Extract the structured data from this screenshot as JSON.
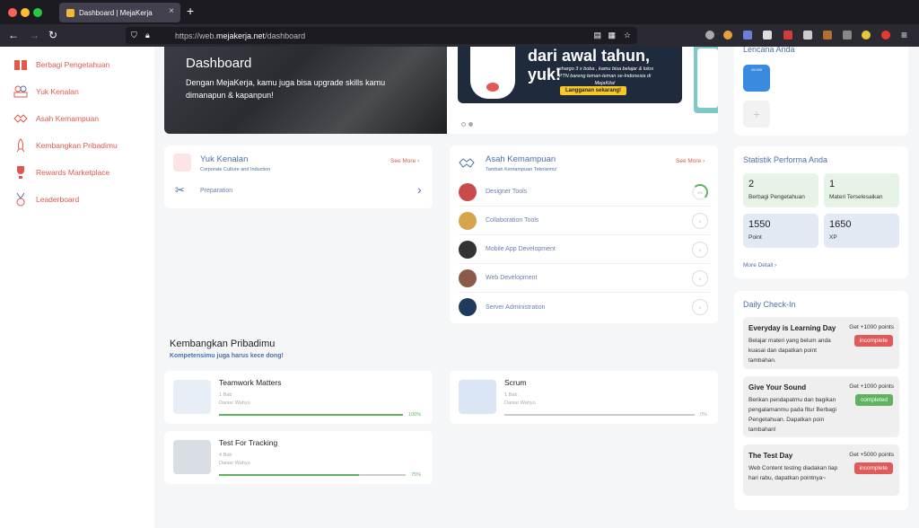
{
  "browser": {
    "tab_title": "Dashboard | MejaKerja",
    "url_prefix": "https://web.",
    "url_domain": "mejakerja.net",
    "url_path": "/dashboard"
  },
  "sidebar": {
    "items": [
      {
        "label": "Berbagi Pengetahuan"
      },
      {
        "label": "Yuk Kenalan"
      },
      {
        "label": "Asah Kemampuan"
      },
      {
        "label": "Kembangkan Pribadimu"
      },
      {
        "label": "Rewards Marketplace"
      },
      {
        "label": "Leaderboard"
      }
    ]
  },
  "hero": {
    "title": "Dashboard",
    "subtitle": "Dengan MejaKerja, kamu juga bisa upgrade skills kamu dimanapun & kapanpun!",
    "promo_title": "dari awal tahun, yuk!",
    "promo_sub": "sehargo 3 x boba , kamu bisa belajar & lolos PTN bareng teman-teman se-Indonesia di MejaKita!",
    "promo_button": "Langganan sekarang!"
  },
  "yuk_kenalan": {
    "title": "Yuk Kenalan",
    "subtitle": "Corporate Culture and Induction",
    "see_more": "See More",
    "items": [
      {
        "label": "Preparation"
      }
    ]
  },
  "asah": {
    "title": "Asah Kemampuan",
    "subtitle": "Tambah Kemampuan Teknisimu!",
    "see_more": "See More",
    "items": [
      {
        "label": "Designer Tools",
        "progress": "3%"
      },
      {
        "label": "Collaboration Tools",
        "progress": "0"
      },
      {
        "label": "Mobile App Development",
        "progress": "0"
      },
      {
        "label": "Web Development",
        "progress": "0"
      },
      {
        "label": "Server Administration",
        "progress": "0"
      }
    ]
  },
  "kembangkan": {
    "title": "Kembangkan Pribadimu",
    "subtitle": "Kompetensimu juga harus kece dong!",
    "courses": [
      {
        "title": "Teamwork Matters",
        "bab": "1 Bab",
        "author": "Daniar Wahyu",
        "pct": "100%",
        "fill": 1.0
      },
      {
        "title": "Scrum",
        "bab": "1 Bab",
        "author": "Daniar Wahyu",
        "pct": "0%",
        "fill": 0.0
      },
      {
        "title": "Test For Tracking",
        "bab": "4 Bab",
        "author": "Daniar Wahyu",
        "pct": "75%",
        "fill": 0.75
      }
    ]
  },
  "lencana": {
    "title": "Lencana Anda",
    "badge_text": "25.000",
    "add": "+"
  },
  "statistik": {
    "title": "Statistik Performa Anda",
    "stats": [
      {
        "value": "2",
        "label": "Berbagi Pengetahuan"
      },
      {
        "value": "1",
        "label": "Materi Terselesaikan"
      },
      {
        "value": "1550",
        "label": "Point"
      },
      {
        "value": "1650",
        "label": "XP"
      }
    ],
    "more_detail": "More Detail"
  },
  "checkin": {
    "title": "Daily Check-In",
    "items": [
      {
        "title": "Everyday is Learning Day",
        "points": "Get +1000 points",
        "desc": "Belajar materi yang belum anda kuasai dan dapatkan point tambahan.",
        "status": "incomplete"
      },
      {
        "title": "Give Your Sound",
        "points": "Get +1000 points",
        "desc": "Berikan pendapatmu dan bagikan pengalamanmu pada fitur Berbagi Pengetahuan. Dapatkan poin tambahan!",
        "status": "completed"
      },
      {
        "title": "The Test Day",
        "points": "Get +5000 points",
        "desc": "Web Content testing diadakan tiap hari rabu, dapatkan pointnya~",
        "status": "incomplete"
      }
    ]
  },
  "colors": {
    "accent_red": "#e0574e",
    "blue_text": "#4c6fa8",
    "green": "#5fb35f"
  }
}
